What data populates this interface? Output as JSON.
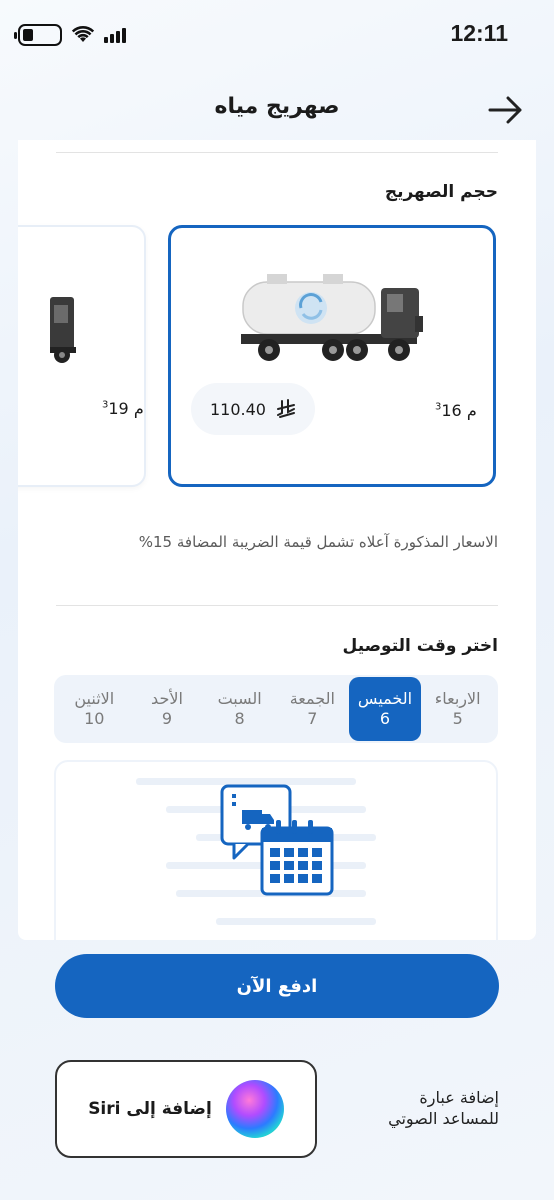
{
  "status_bar": {
    "time": "12:11"
  },
  "header": {
    "title": "صهريج مياه"
  },
  "tank_size": {
    "title": "حجم الصهريج",
    "options": [
      {
        "volume": "16 م",
        "price": "110.40",
        "selected": true
      },
      {
        "volume": "19 م",
        "selected": false
      }
    ],
    "volume_superscript": "3"
  },
  "vat_note": "الاسعار المذكورة آعلاه تشمل قيمة الضريبة المضافة 15%",
  "delivery": {
    "title": "اختر وقت التوصيل",
    "days": [
      {
        "name": "الاربعاء",
        "num": "5",
        "selected": false
      },
      {
        "name": "الخميس",
        "num": "6",
        "selected": true
      },
      {
        "name": "الجمعة",
        "num": "7",
        "selected": false
      },
      {
        "name": "السبت",
        "num": "8",
        "selected": false
      },
      {
        "name": "الأحد",
        "num": "9",
        "selected": false
      },
      {
        "name": "الاثنين",
        "num": "10",
        "selected": false
      }
    ]
  },
  "pay_button": "ادفع الآن",
  "siri": {
    "button_label": "إضافة إلى Siri",
    "description": [
      "إضافة عبارة",
      "للمساعد الصوتي"
    ]
  },
  "colors": {
    "primary": "#1565c0",
    "pill_bg": "#f3f6fa",
    "strip_bg": "#eef3fa"
  }
}
